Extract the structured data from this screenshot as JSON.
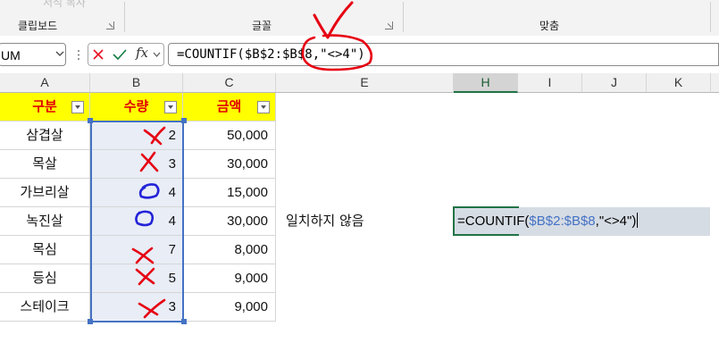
{
  "ribbon": {
    "faded_text": "서식 복사",
    "groups": [
      "클립보드",
      "글꼴",
      "맞춤"
    ]
  },
  "namebox": {
    "value": "UM"
  },
  "formula_bar": {
    "fx_label": "fx",
    "formula": "=COUNTIF($B$2:$B$8,\"<>4\")"
  },
  "columns": [
    "A",
    "B",
    "C",
    "E",
    "H",
    "I",
    "J",
    "K"
  ],
  "table": {
    "headers": [
      "구분",
      "수량",
      "금액"
    ],
    "rows": [
      [
        "삼겹살",
        "2",
        "50,000"
      ],
      [
        "목살",
        "3",
        "30,000"
      ],
      [
        "가브리살",
        "4",
        "15,000"
      ],
      [
        "녹진살",
        "4",
        "30,000"
      ],
      [
        "목심",
        "7",
        "8,000"
      ],
      [
        "등심",
        "5",
        "9,000"
      ],
      [
        "스테이크",
        "3",
        "9,000"
      ]
    ]
  },
  "e8": "일치하지 않음",
  "h8": {
    "prefix": "=COUNTIF(",
    "range": "$B$2:$B$8",
    "suffix": ",\"<>4\")"
  },
  "colors": {
    "header_fill": "#ffff00",
    "header_text": "#e00000",
    "selection_green": "#217346",
    "range_blue": "#4472c4",
    "annotation_red": "#e60012",
    "annotation_blue": "#2323d8"
  }
}
